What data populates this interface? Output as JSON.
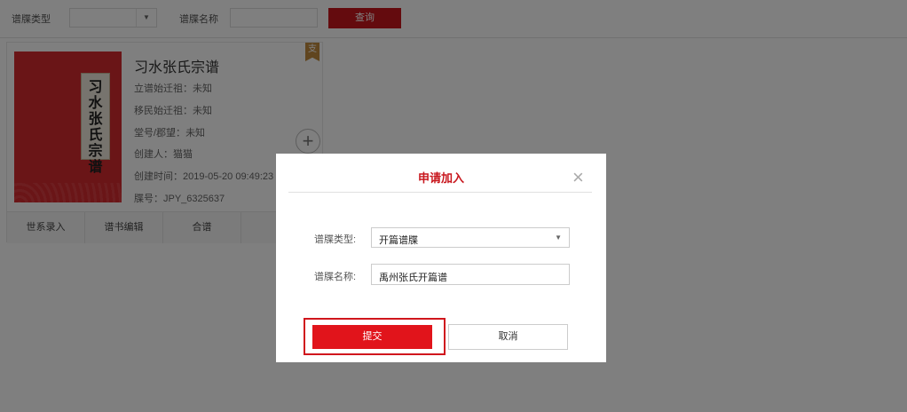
{
  "filter": {
    "type_label": "谱牒类型",
    "type_value": "",
    "name_label": "谱牒名称",
    "name_value": "",
    "query_button": "查询"
  },
  "card": {
    "cover_chars": [
      "习",
      "水",
      "张",
      "氏",
      "宗",
      "谱"
    ],
    "title": "习水张氏宗谱",
    "badge": "支",
    "rows": [
      {
        "label": "立谱始迁祖：",
        "value": "未知"
      },
      {
        "label": "移民始迁祖：",
        "value": "未知"
      },
      {
        "label": "堂号/郡望：",
        "value": "未知"
      },
      {
        "label": "创建人：",
        "value": "猫猫"
      },
      {
        "label": "创建时间：",
        "value": "2019-05-20 09:49:23"
      },
      {
        "label": "牒号：",
        "value": "JPY_6325637"
      }
    ],
    "tabs": [
      "世系录入",
      "谱书编辑",
      "合谱",
      ""
    ]
  },
  "dialog": {
    "title": "申请加入",
    "close_icon": "×",
    "type_label": "谱牒类型:",
    "type_value": "开篇谱牒",
    "name_label": "谱牒名称:",
    "name_value": "禹州张氏开篇谱",
    "submit_label": "提交",
    "cancel_label": "取消"
  },
  "colors": {
    "accent": "#c8161d",
    "submit": "#e1141b",
    "overlay": "rgba(0,0,0,0.50)"
  }
}
